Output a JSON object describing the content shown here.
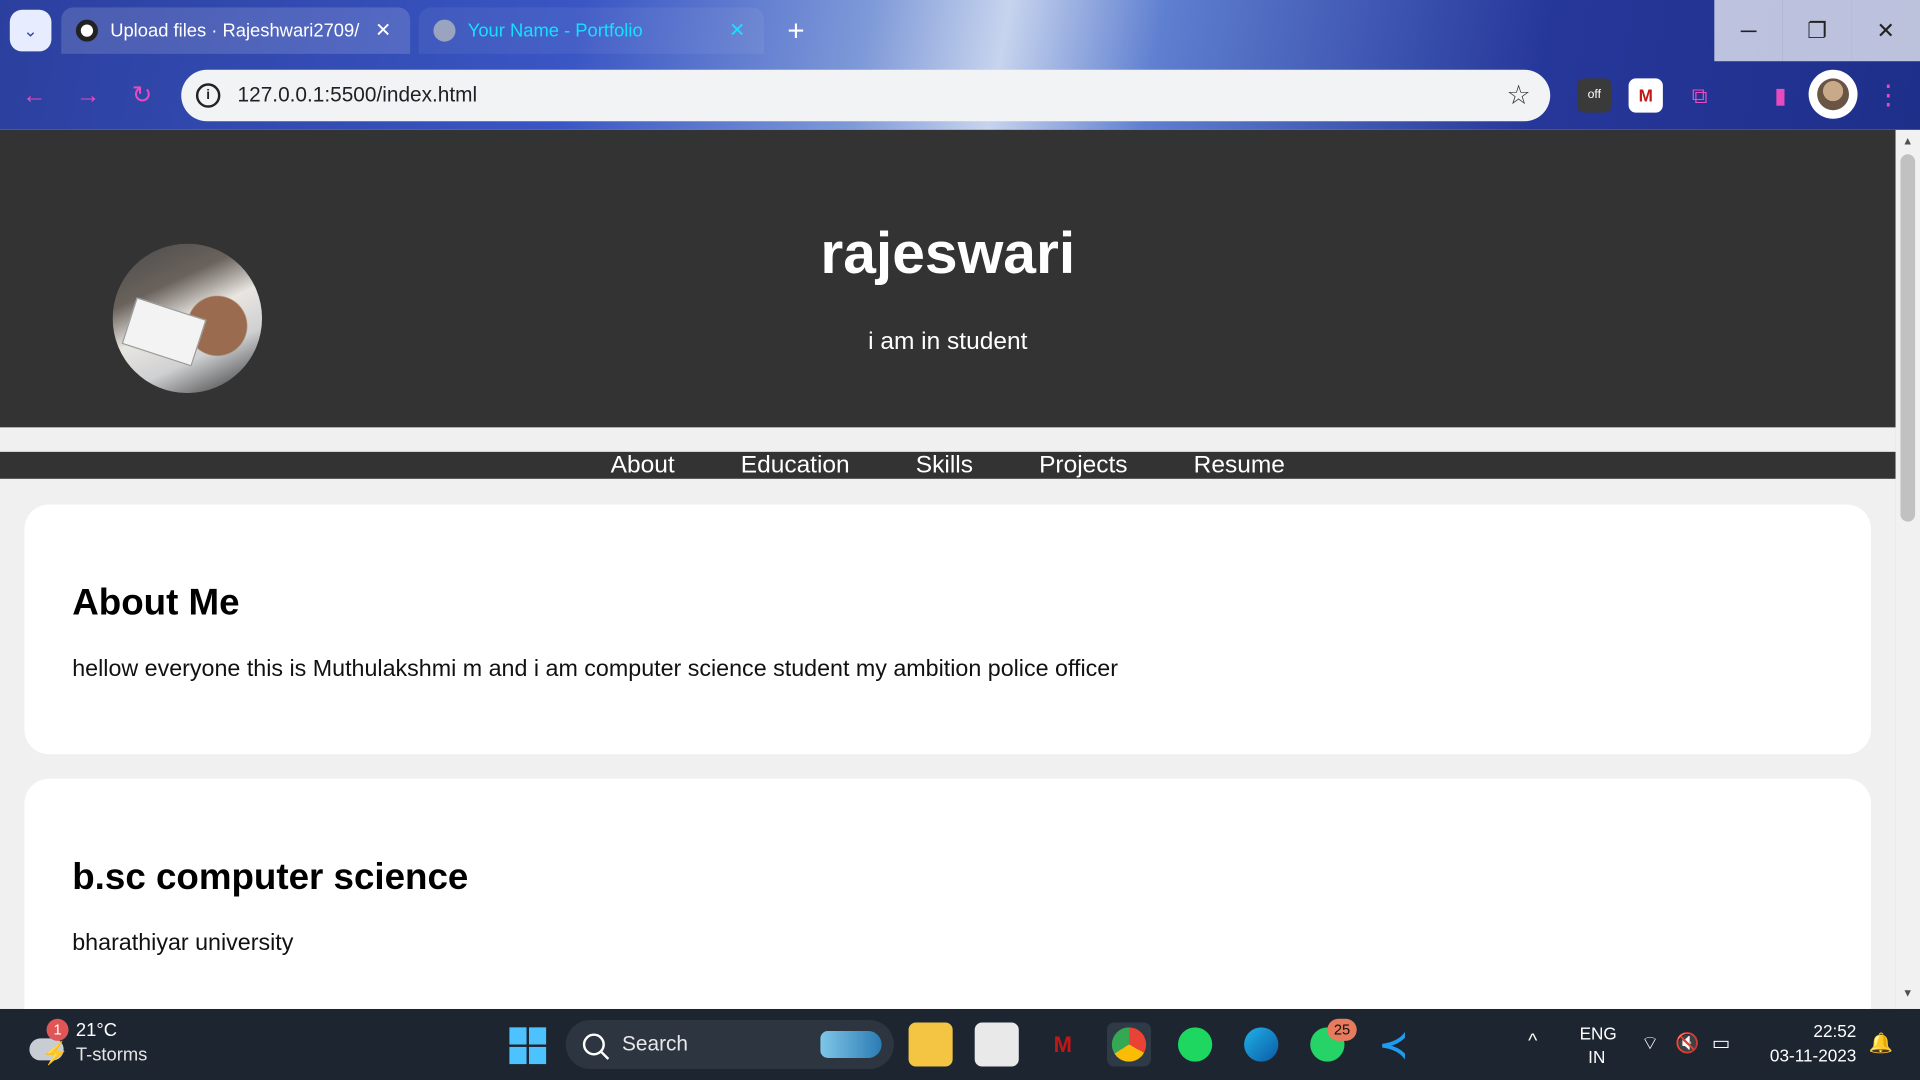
{
  "browser": {
    "tabs": [
      {
        "label": "Upload files · Rajeshwari2709/",
        "close": "✕"
      },
      {
        "label": "Your Name - Portfolio",
        "close": "✕"
      }
    ],
    "new_tab": "+",
    "window_controls": {
      "minimize": "─",
      "restore": "❐",
      "close": "✕"
    },
    "nav": {
      "back": "←",
      "forward": "→",
      "reload": "↻"
    },
    "address": "127.0.0.1:5500/index.html",
    "info_glyph": "i",
    "star": "☆",
    "extensions": [
      {
        "name": "extension-off-icon",
        "glyph": "off"
      },
      {
        "name": "mcafee-extension-icon",
        "glyph": "M"
      },
      {
        "name": "puzzle-extensions-icon",
        "glyph": "⧉"
      },
      {
        "name": "side-panel-icon",
        "glyph": "▮"
      }
    ],
    "menu": "⋮"
  },
  "page": {
    "header": {
      "title": "rajeswari",
      "subtitle": "i am in student"
    },
    "nav": [
      "About",
      "Education",
      "Skills",
      "Projects",
      "Resume"
    ],
    "about": {
      "heading": "About Me",
      "text": "hellow everyone this is Muthulakshmi m and i am computer science student my ambition police officer"
    },
    "education": {
      "heading": "b.sc computer science",
      "text": "bharathiyar university"
    }
  },
  "taskbar": {
    "weather_badge": "1",
    "temperature": "21°C",
    "condition": "T-storms",
    "search_label": "Search",
    "whatsapp_badge": "25",
    "language_line1": "ENG",
    "language_line2": "IN",
    "time": "22:52",
    "date": "03-11-2023",
    "tray_glyphs": {
      "caret": "^",
      "wifi": "⌔",
      "volume": "🔇",
      "battery": "▭",
      "notifications": "🔔"
    }
  },
  "colors": {
    "header_bg": "#333333",
    "page_bg": "#f0f0f0",
    "active_tab_text": "#17e0ff",
    "taskbar_bg": "#1c2530"
  }
}
